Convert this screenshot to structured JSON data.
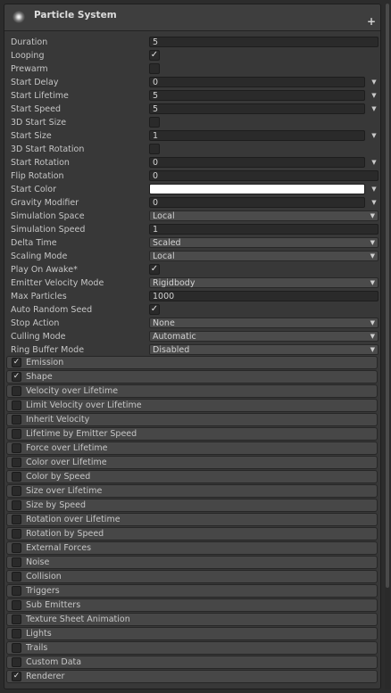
{
  "header": {
    "title": "Particle System",
    "add_icon": "plus-icon",
    "orb_icon": "particle-orb-icon"
  },
  "properties": [
    {
      "label": "Duration",
      "value": "5",
      "kind": "field"
    },
    {
      "label": "Looping",
      "checked": true,
      "kind": "check"
    },
    {
      "label": "Prewarm",
      "checked": false,
      "kind": "check"
    },
    {
      "label": "Start Delay",
      "value": "0",
      "kind": "field-dd"
    },
    {
      "label": "Start Lifetime",
      "value": "5",
      "kind": "field-dd"
    },
    {
      "label": "Start Speed",
      "value": "5",
      "kind": "field-dd"
    },
    {
      "label": "3D Start Size",
      "checked": false,
      "kind": "check"
    },
    {
      "label": "Start Size",
      "value": "1",
      "kind": "field-dd"
    },
    {
      "label": "3D Start Rotation",
      "checked": false,
      "kind": "check"
    },
    {
      "label": "Start Rotation",
      "value": "0",
      "kind": "field-dd"
    },
    {
      "label": "Flip Rotation",
      "value": "0",
      "kind": "field"
    },
    {
      "label": "Start Color",
      "color": "#ffffff",
      "kind": "color"
    },
    {
      "label": "Gravity Modifier",
      "value": "0",
      "kind": "field-dd"
    },
    {
      "label": "Simulation Space",
      "value": "Local",
      "kind": "popup"
    },
    {
      "label": "Simulation Speed",
      "value": "1",
      "kind": "field"
    },
    {
      "label": "Delta Time",
      "value": "Scaled",
      "kind": "popup"
    },
    {
      "label": "Scaling Mode",
      "value": "Local",
      "kind": "popup"
    },
    {
      "label": "Play On Awake*",
      "checked": true,
      "kind": "check"
    },
    {
      "label": "Emitter Velocity Mode",
      "value": "Rigidbody",
      "kind": "popup"
    },
    {
      "label": "Max Particles",
      "value": "1000",
      "kind": "field"
    },
    {
      "label": "Auto Random Seed",
      "checked": true,
      "kind": "check"
    },
    {
      "label": "Stop Action",
      "value": "None",
      "kind": "popup"
    },
    {
      "label": "Culling Mode",
      "value": "Automatic",
      "kind": "popup"
    },
    {
      "label": "Ring Buffer Mode",
      "value": "Disabled",
      "kind": "popup"
    }
  ],
  "modules": [
    {
      "label": "Emission",
      "enabled": true
    },
    {
      "label": "Shape",
      "enabled": true
    },
    {
      "label": "Velocity over Lifetime",
      "enabled": false
    },
    {
      "label": "Limit Velocity over Lifetime",
      "enabled": false
    },
    {
      "label": "Inherit Velocity",
      "enabled": false
    },
    {
      "label": "Lifetime by Emitter Speed",
      "enabled": false
    },
    {
      "label": "Force over Lifetime",
      "enabled": false
    },
    {
      "label": "Color over Lifetime",
      "enabled": false
    },
    {
      "label": "Color by Speed",
      "enabled": false
    },
    {
      "label": "Size over Lifetime",
      "enabled": false
    },
    {
      "label": "Size by Speed",
      "enabled": false
    },
    {
      "label": "Rotation over Lifetime",
      "enabled": false
    },
    {
      "label": "Rotation by Speed",
      "enabled": false
    },
    {
      "label": "External Forces",
      "enabled": false
    },
    {
      "label": "Noise",
      "enabled": false
    },
    {
      "label": "Collision",
      "enabled": false
    },
    {
      "label": "Triggers",
      "enabled": false
    },
    {
      "label": "Sub Emitters",
      "enabled": false
    },
    {
      "label": "Texture Sheet Animation",
      "enabled": false
    },
    {
      "label": "Lights",
      "enabled": false
    },
    {
      "label": "Trails",
      "enabled": false
    },
    {
      "label": "Custom Data",
      "enabled": false
    },
    {
      "label": "Renderer",
      "enabled": true
    }
  ]
}
